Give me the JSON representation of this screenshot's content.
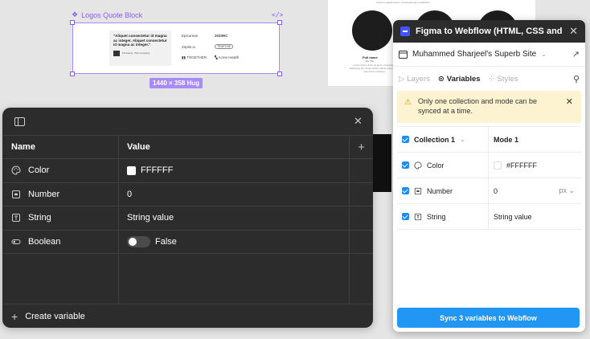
{
  "canvas": {
    "frame_label": "Logos Quote Block",
    "frame_code_icon": "code-icon",
    "size_badge": "1440 × 358 Hug",
    "quote": {
      "text": "\"Aliquet consectetur id magna ac integer. Aliquet consectetur id magna ac integer.\"",
      "author": "Firstname, Title Company"
    },
    "logos": [
      "Epicurean",
      "2020RC",
      "Zeplin.io",
      "TEMPOSE",
      "TOGETHER",
      "Acme Health"
    ],
    "profile": {
      "tagline": "Vivamus sagittis lacus, consequat eget vestibulum",
      "name": "Full name",
      "title": "Job Title",
      "description": "Lorem ipsum dolor sit amet, consectetur adipiscing elit. Suspendisse varius enim in eros elementum tristique."
    }
  },
  "variables_panel": {
    "columns": {
      "name": "Name",
      "value": "Value"
    },
    "rows": [
      {
        "icon": "palette-icon",
        "name": "Color",
        "value": "FFFFFF",
        "swatch": "#FFFFFF"
      },
      {
        "icon": "number-icon",
        "name": "Number",
        "value": "0"
      },
      {
        "icon": "text-icon",
        "name": "String",
        "value": "String value"
      },
      {
        "icon": "toggle-icon",
        "name": "Boolean",
        "value": "False"
      }
    ],
    "create_label": "Create variable"
  },
  "plugin": {
    "title": "Figma to Webflow (HTML, CSS and ...",
    "site_name": "Muhammed Sharjeel's Superb Site",
    "tabs": [
      {
        "label": "Layers",
        "active": false
      },
      {
        "label": "Variables",
        "active": true
      },
      {
        "label": "Styles",
        "active": false
      }
    ],
    "notice": "Only one collection and mode can be synced at a time.",
    "collection": "Collection 1",
    "mode": "Mode 1",
    "rows": [
      {
        "icon": "palette-icon",
        "name": "Color",
        "value": "#FFFFFF"
      },
      {
        "icon": "number-icon",
        "name": "Number",
        "value": "0",
        "unit": "px"
      },
      {
        "icon": "text-icon",
        "name": "String",
        "value": "String value"
      }
    ],
    "sync_button": "Sync 3 variables to Webflow",
    "colors": {
      "accent": "#2196F3",
      "notice_bg": "#FDF3D0",
      "webflow": "#4353FF"
    }
  }
}
